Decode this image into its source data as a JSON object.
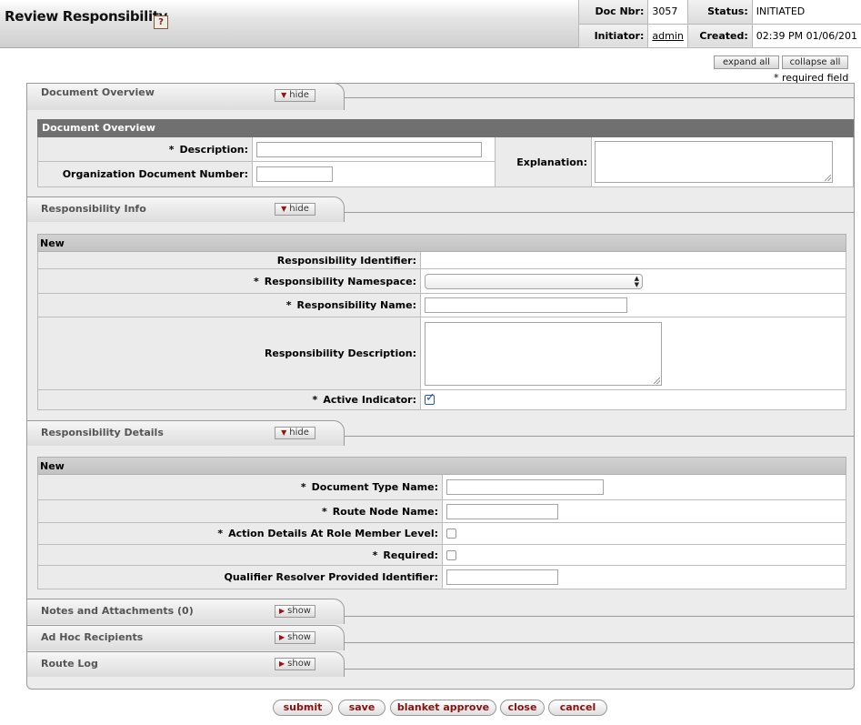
{
  "header": {
    "title": "Review Responsibility",
    "help_glyph": "?",
    "doc_info": {
      "doc_nbr_label": "Doc Nbr:",
      "doc_nbr": "3057",
      "status_label": "Status:",
      "status": "INITIATED",
      "initiator_label": "Initiator:",
      "initiator": "admin",
      "created_label": "Created:",
      "created": "02:39 PM 01/06/201"
    }
  },
  "controls": {
    "expand_all": "expand all",
    "collapse_all": "collapse all",
    "required_note": "* required field"
  },
  "tabs": {
    "hide_label": "hide",
    "show_label": "show",
    "document_overview": "Document Overview",
    "responsibility_info": "Responsibility Info",
    "responsibility_details": "Responsibility Details",
    "notes": "Notes and Attachments (0)",
    "adhoc": "Ad Hoc Recipients",
    "route_log": "Route Log"
  },
  "document_overview": {
    "section_title": "Document Overview",
    "description_label": "Description:",
    "org_doc_number_label": "Organization Document Number:",
    "explanation_label": "Explanation:",
    "description_value": "",
    "org_doc_number_value": "",
    "explanation_value": ""
  },
  "responsibility_info": {
    "sub_title": "New",
    "identifier_label": "Responsibility Identifier:",
    "identifier_value": "",
    "namespace_label": "Responsibility Namespace:",
    "namespace_value": "",
    "name_label": "Responsibility Name:",
    "name_value": "",
    "description_label": "Responsibility Description:",
    "description_value": "",
    "active_label": "Active Indicator:",
    "active_checked": true
  },
  "responsibility_details": {
    "sub_title": "New",
    "doc_type_label": "Document Type Name:",
    "doc_type_value": "",
    "route_node_label": "Route Node Name:",
    "route_node_value": "",
    "action_details_label": "Action Details At Role Member Level:",
    "action_details_checked": false,
    "required_label": "Required:",
    "required_checked": false,
    "qualifier_label": "Qualifier Resolver Provided Identifier:",
    "qualifier_value": ""
  },
  "required_marker": "*",
  "buttons": {
    "submit": "submit",
    "save": "save",
    "blanket_approve": "blanket approve",
    "close": "close",
    "cancel": "cancel"
  },
  "colors": {
    "section_bar": "#707070",
    "button_text": "#8a1010",
    "checkbox_blue": "#2a55a8"
  }
}
